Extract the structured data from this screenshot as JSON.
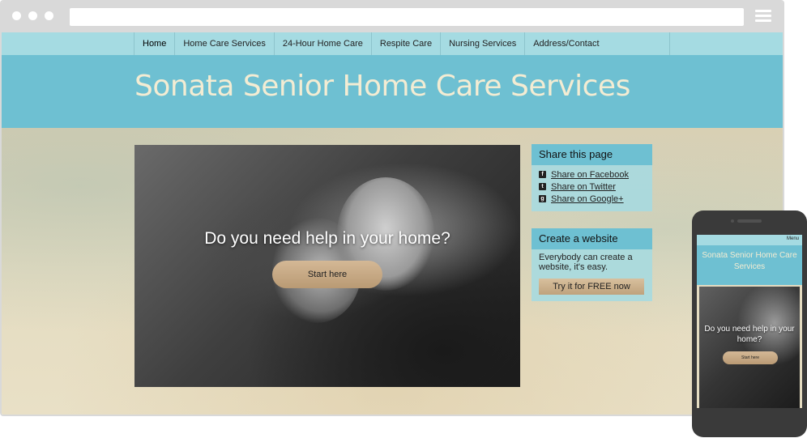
{
  "nav": {
    "items": [
      {
        "label": "Home",
        "active": true
      },
      {
        "label": "Home Care Services",
        "active": false
      },
      {
        "label": "24-Hour Home Care",
        "active": false
      },
      {
        "label": "Respite Care",
        "active": false
      },
      {
        "label": "Nursing Services",
        "active": false
      },
      {
        "label": "Address/Contact",
        "active": false
      }
    ]
  },
  "header": {
    "title": "Sonata Senior Home Care Services"
  },
  "hero": {
    "headline": "Do you need help in your home?",
    "button_label": "Start here"
  },
  "share": {
    "heading": "Share this page",
    "items": [
      {
        "label": "Share on Facebook",
        "icon": "facebook-icon",
        "glyph": "f"
      },
      {
        "label": "Share on Twitter",
        "icon": "twitter-icon",
        "glyph": "t"
      },
      {
        "label": "Share on Google+",
        "icon": "google-plus-icon",
        "glyph": "g"
      }
    ]
  },
  "create": {
    "heading": "Create a website",
    "text": "Everybody can create a website, it's easy.",
    "button_label": "Try it for FREE now"
  },
  "mobile": {
    "menu_label": "Menu",
    "title": "Sonata Senior Home Care Services",
    "hero_headline": "Do you need help in your home?",
    "hero_button_label": "Start here"
  },
  "colors": {
    "nav_bg": "#a5dbe2",
    "header_bg": "#6ec0d2",
    "title_text": "#f3ecd3",
    "button_tan": "#c9ab86"
  }
}
